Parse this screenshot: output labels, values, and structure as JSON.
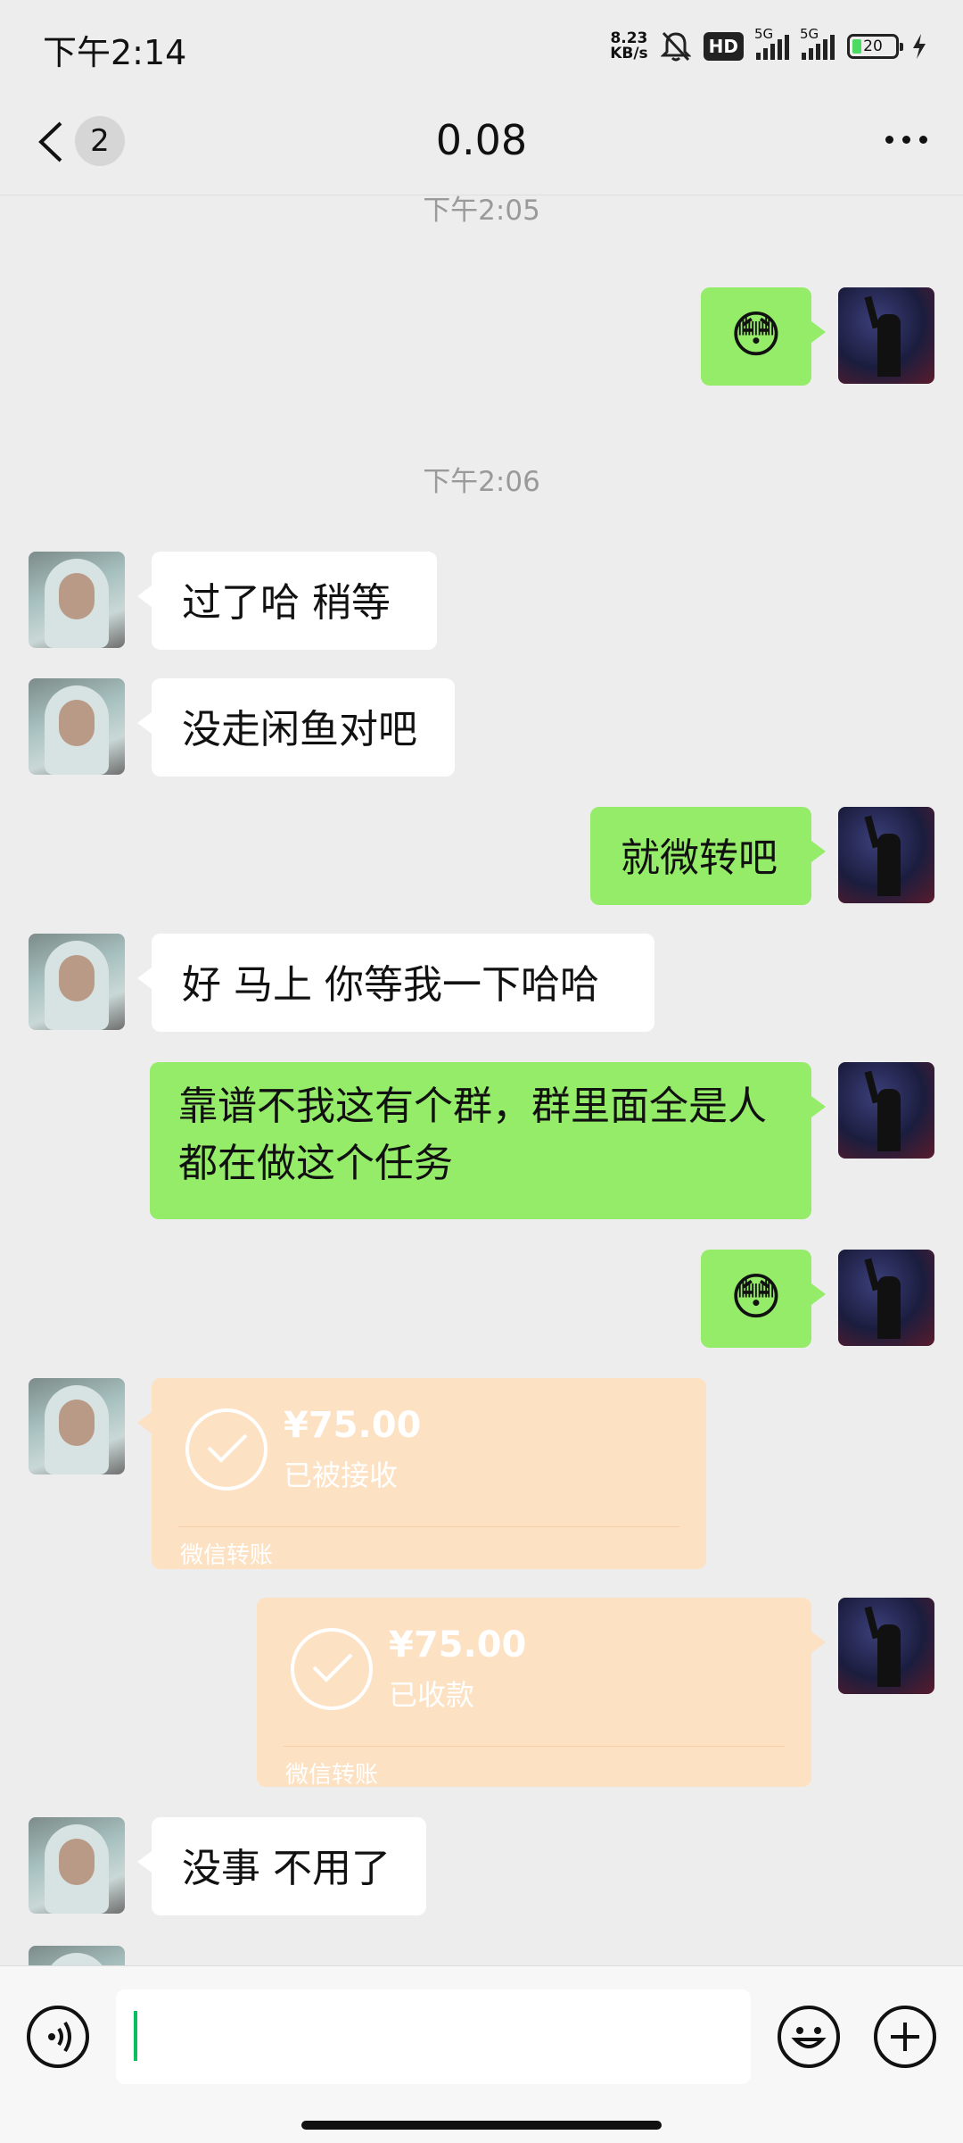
{
  "status_bar": {
    "time": "下午2:14",
    "net_speed_value": "8.23",
    "net_speed_unit": "KB/s",
    "hd_label": "HD",
    "signal1_label": "5G",
    "signal2_label": "5G",
    "battery": "20"
  },
  "nav": {
    "unread_count": "2",
    "title": "0.08"
  },
  "messages": {
    "ts1": "下午2:05",
    "ts2": "下午2:06",
    "m1_emoji": "😳",
    "m2_text": "过了哈 稍等",
    "m3_text": "没走闲鱼对吧",
    "m4_text": "就微转吧",
    "m5_text": "好 马上 你等我一下哈哈",
    "m6_text": "靠谱不我这有个群，群里面全是人都在做这个任务",
    "m7_emoji": "😳",
    "m8_amount": "¥75.00",
    "m8_status": "已被接收",
    "m8_footer": "微信转账",
    "m9_amount": "¥75.00",
    "m9_status": "已收款",
    "m9_footer": "微信转账",
    "m10_text": "没事 不用了"
  },
  "icons": {
    "back": "chevron-left-icon",
    "more": "more-dots-icon",
    "voice": "voice-icon",
    "emoji": "emoji-icon",
    "plus": "plus-icon",
    "check": "check-icon",
    "mute": "bell-off-icon",
    "charging": "lightning-icon"
  },
  "colors": {
    "background": "#ededed",
    "my_bubble": "#95ec69",
    "other_bubble": "#ffffff",
    "transfer_bubble": "#fde1c3",
    "caret": "#07c160"
  }
}
